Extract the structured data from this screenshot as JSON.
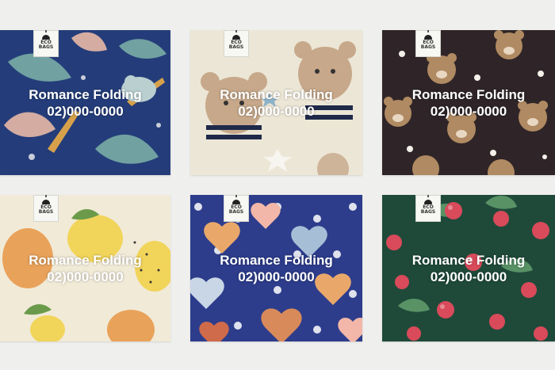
{
  "tiles": [
    {
      "id": "tropical-leaves",
      "title": "Romance Folding",
      "phone": "02)000-0000",
      "tag": "ECO BAGS",
      "bg": "#243d7a"
    },
    {
      "id": "teddy-bears-cream",
      "title": "Romance Folding",
      "phone": "02)000-0000",
      "tag": "ECO BAGS",
      "bg": "#ece6d6"
    },
    {
      "id": "bear-faces-dark",
      "title": "Romance Folding",
      "phone": "02)000-0000",
      "tag": "ECO BAGS",
      "bg": "#2f2528"
    },
    {
      "id": "lemons",
      "title": "Romance Folding",
      "phone": "02)000-0000",
      "tag": "ECO BAGS",
      "bg": "#f1ead7"
    },
    {
      "id": "hearts-polka",
      "title": "Romance Folding",
      "phone": "02)000-0000",
      "tag": "ECO BAGS",
      "bg": "#2d3d8c"
    },
    {
      "id": "cherries-green",
      "title": "Romance Folding",
      "phone": "02)000-0000",
      "tag": "ECO BAGS",
      "bg": "#1f4a3a"
    }
  ]
}
